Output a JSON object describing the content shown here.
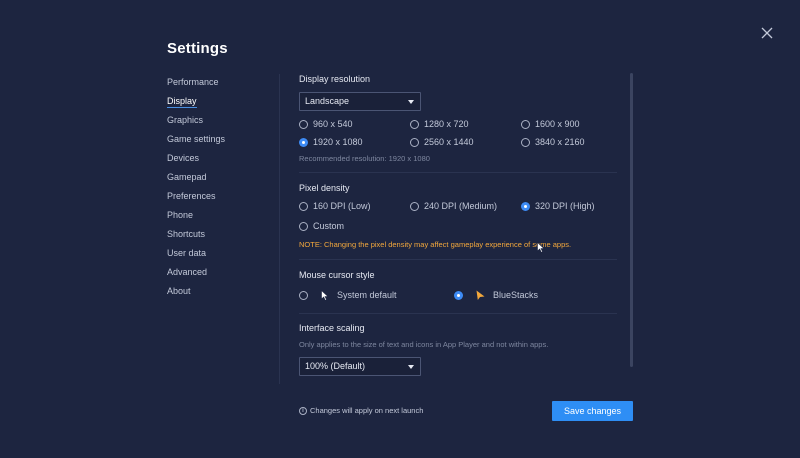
{
  "title": "Settings",
  "nav": {
    "items": [
      {
        "label": "Performance"
      },
      {
        "label": "Display"
      },
      {
        "label": "Graphics"
      },
      {
        "label": "Game settings"
      },
      {
        "label": "Devices"
      },
      {
        "label": "Gamepad"
      },
      {
        "label": "Preferences"
      },
      {
        "label": "Phone"
      },
      {
        "label": "Shortcuts"
      },
      {
        "label": "User data"
      },
      {
        "label": "Advanced"
      },
      {
        "label": "About"
      }
    ],
    "active": "Display"
  },
  "display_resolution": {
    "title": "Display resolution",
    "orientation": "Landscape",
    "options": [
      "960 x 540",
      "1280 x 720",
      "1600 x 900",
      "1920 x 1080",
      "2560 x 1440",
      "3840 x 2160"
    ],
    "selected": "1920 x 1080",
    "hint": "Recommended resolution: 1920 x 1080"
  },
  "pixel_density": {
    "title": "Pixel density",
    "options": [
      "160 DPI (Low)",
      "240 DPI (Medium)",
      "320 DPI (High)",
      "Custom"
    ],
    "selected": "320 DPI (High)",
    "note": "NOTE: Changing the pixel density may affect gameplay experience of some apps."
  },
  "mouse_cursor": {
    "title": "Mouse cursor style",
    "options": [
      "System default",
      "BlueStacks"
    ],
    "selected": "BlueStacks"
  },
  "interface_scaling": {
    "title": "Interface scaling",
    "hint": "Only applies to the size of text and icons in App Player and not within apps.",
    "value": "100% (Default)"
  },
  "footer": {
    "note": "Changes will apply on next launch",
    "save_label": "Save changes"
  },
  "colors": {
    "background": "#1d2540",
    "accent": "#2e8ef5",
    "note": "#f3a83c"
  }
}
